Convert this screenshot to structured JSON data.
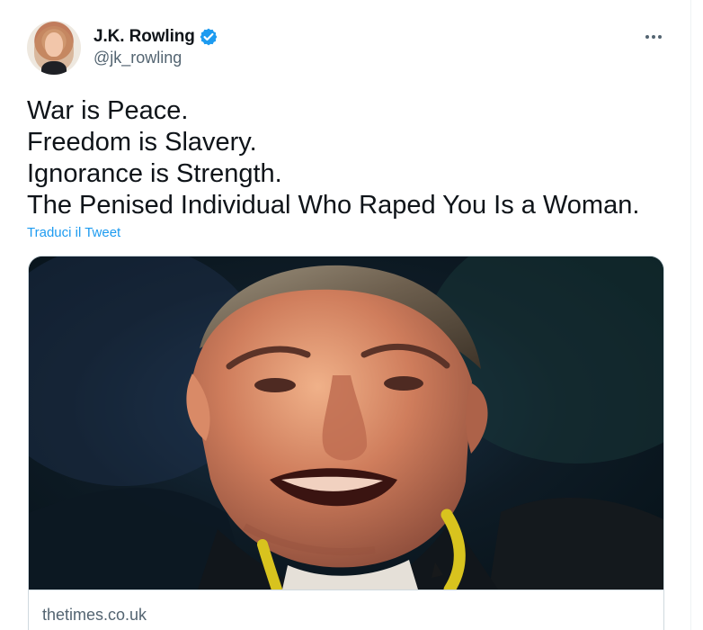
{
  "tweet": {
    "author": {
      "display_name": "J.K. Rowling",
      "handle": "@jk_rowling",
      "verified_icon": "verified-badge-icon",
      "avatar": "profile-photo"
    },
    "text_lines": [
      "War is Peace.",
      "Freedom is Slavery.",
      "Ignorance is Strength.",
      "The Penised Individual Who Raped You Is a Woman."
    ],
    "translate_label": "Traduci il Tweet",
    "more_icon": "more-options-icon",
    "card": {
      "domain": "thetimes.co.uk",
      "image": "man-speaking-at-conference-photo"
    }
  },
  "colors": {
    "text": "#0f1419",
    "secondary_text": "#536471",
    "link": "#1d9bf0",
    "border": "#cfd9de"
  }
}
